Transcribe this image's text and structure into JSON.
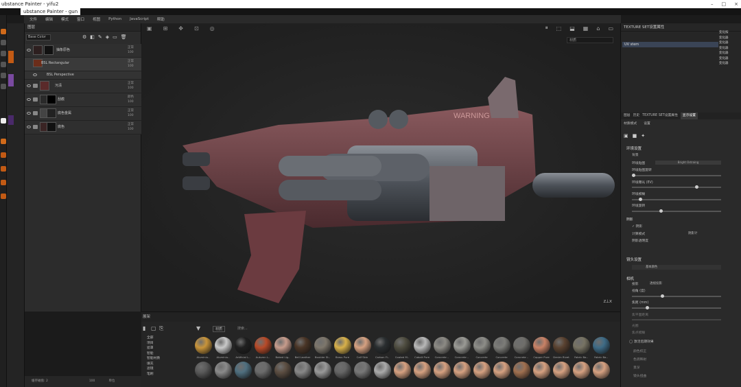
{
  "window": {
    "title": "ubstance Painter - yifu2",
    "subtitle": "ubstance Painter - gun",
    "controls": [
      "–",
      "□",
      "×"
    ]
  },
  "menu": [
    "文件",
    "编辑",
    "模式",
    "窗口",
    "视图",
    "Python",
    "JavaScript",
    "帮助"
  ],
  "layers": {
    "header": "图层",
    "channel": "Base Color",
    "rows": [
      {
        "name": "抽象原色",
        "blend": "正常",
        "opacity": "100"
      },
      {
        "name": "BSL Rectangular",
        "blend": "正常",
        "opacity": "100"
      },
      {
        "name": "BSL Perspective",
        "blend": "",
        "opacity": ""
      },
      {
        "name": "污渍",
        "blend": "正常",
        "opacity": "100"
      },
      {
        "name": "刮痕",
        "blend": "颜色",
        "opacity": "100"
      },
      {
        "name": "底色金属",
        "blend": "正常",
        "opacity": "100"
      },
      {
        "name": "底色",
        "blend": "正常",
        "opacity": "100"
      }
    ]
  },
  "viewport": {
    "camera": "材质"
  },
  "texture_set": {
    "header": "TEXTURE SET设置属性",
    "selected": "UV stem",
    "list": [
      "变化按",
      "变化器",
      "变化器",
      "变化器",
      "变化器",
      "变化器",
      "变化器"
    ]
  },
  "properties": {
    "tabs": [
      "图层",
      "历史",
      "TEXTURE SET设置属性",
      "显示设置"
    ],
    "active_tab": "显示设置",
    "sub": [
      "材质模式",
      "设置"
    ],
    "section1": "环境设置",
    "fields": [
      {
        "label": "背景",
        "value": ""
      },
      {
        "label": "环境贴图",
        "value": "Bright Ostraing"
      },
      {
        "label": "环境贴图旋转"
      },
      {
        "label": "环境曝光 (EV)"
      },
      {
        "label": "环境模糊"
      },
      {
        "label": "环境旋转"
      }
    ],
    "shadow_label": "阴影",
    "shadow_check": "阴影",
    "shadow_mode": "计算模式",
    "shadow_mode_val": "阴影计",
    "shadow_opacity": "阴影透明度",
    "section2": "镜头设置",
    "lens_label": "基本颜色",
    "section3": "相机",
    "cam_fields": [
      "投影",
      "视角 (度)",
      "焦距 (mm)",
      "焦平面距离",
      "光圈",
      "焦点模糊"
    ],
    "cam_proj_val": "透视投影",
    "post": [
      "激活后期效果",
      "颜色校正",
      "色调映射",
      "景深",
      "镜头扭曲"
    ]
  },
  "shelf": {
    "header": "展架",
    "search": "搜索...",
    "tab": "材质",
    "categories": [
      "全部",
      "项目",
      "遮罩",
      "智能",
      "智能材质",
      "填充",
      "滤镜",
      "笔刷"
    ],
    "materials": [
      {
        "name": "Aluminiu..",
        "color": "#c8943a"
      },
      {
        "name": "Aluminiu..",
        "color": "#c9c9c9"
      },
      {
        "name": "Artificial L..",
        "color": "#202020"
      },
      {
        "name": "Autumn L..",
        "color": "#b84a28"
      },
      {
        "name": "Baked Lig..",
        "color": "#c79c8c"
      },
      {
        "name": "Bell Leather",
        "color": "#4a3526"
      },
      {
        "name": "Boulder St..",
        "color": "#7d766b"
      },
      {
        "name": "Brass Pure",
        "color": "#d8b14a"
      },
      {
        "name": "Calf Skin",
        "color": "#d6a181"
      },
      {
        "name": "Carbon Fi..",
        "color": "#2a2e30"
      },
      {
        "name": "Coated M..",
        "color": "#4f4d40"
      },
      {
        "name": "Cobalt Pure",
        "color": "#b8b8b8"
      },
      {
        "name": "Concrete ..",
        "color": "#8c8a84"
      },
      {
        "name": "Concrete ..",
        "color": "#9a9a95"
      },
      {
        "name": "Concrete",
        "color": "#8d8d88"
      },
      {
        "name": "Concrete",
        "color": "#7c7c78"
      },
      {
        "name": "Concrete ..",
        "color": "#6f6e6a"
      },
      {
        "name": "Copper Pure",
        "color": "#c98266"
      },
      {
        "name": "Denim Rivet",
        "color": "#5a4230"
      },
      {
        "name": "Fabric Ba..",
        "color": "#777363"
      },
      {
        "name": "Fabric Ba..",
        "color": "#3e6b86"
      }
    ],
    "row2": [
      "#5a5a5a",
      "#8a8a8a",
      "#4f6f7f",
      "#6b6b6b",
      "#5c4e42",
      "#888",
      "#999",
      "#666",
      "#777",
      "#aaa",
      "#d6a181",
      "#d6a181",
      "#d6a181",
      "#d6a181",
      "#d6a181",
      "#d6a181",
      "#a07050",
      "#d6a181",
      "#d6a181",
      "#d6a181",
      "#d6a181"
    ]
  },
  "bottom": {
    "status": "缓存磁盘: 2",
    "zoom": "100",
    "extra": "单位"
  }
}
